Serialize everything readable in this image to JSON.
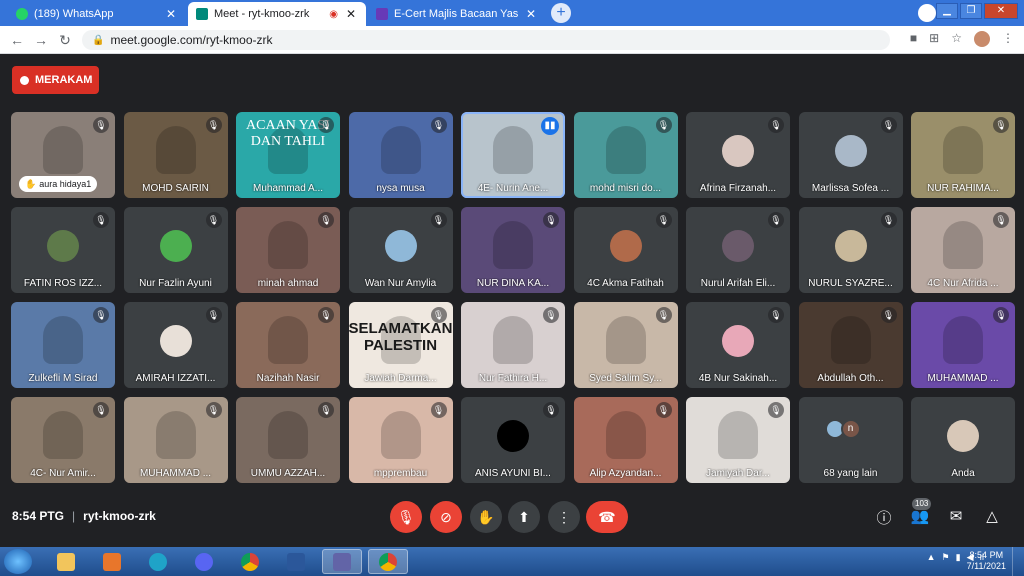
{
  "browser": {
    "tabs": [
      {
        "title": "(189) WhatsApp",
        "favicon_color": "#25d366"
      },
      {
        "title": "Meet - ryt-kmoo-zrk",
        "favicon_color": "#00897b",
        "active": true
      },
      {
        "title": "E-Cert Majlis Bacaan Yasin dan T",
        "favicon_color": "#673ab7"
      }
    ],
    "url": "meet.google.com/ryt-kmoo-zrk"
  },
  "meet": {
    "record_label": "MERAKAM",
    "hand_raised_name": "aura hidaya1",
    "tile_banner_1": "ACAAN YASI DAN TAHLI",
    "tile_banner_2": "SELAMATKAN PALESTIN",
    "participants": [
      {
        "name": "",
        "bg": "#8a7f78"
      },
      {
        "name": "MOHD SAIRIN",
        "bg": "#6b5a45"
      },
      {
        "name": "Muhammad A...",
        "bg": "#2aa8a8"
      },
      {
        "name": "nysa musa",
        "bg": "#4d6aa8"
      },
      {
        "name": "4E- Nurin Ane...",
        "bg": "#b8c4cc"
      },
      {
        "name": "mohd misri do...",
        "bg": "#4a9a9a"
      },
      {
        "name": "Afrina Firzanah...",
        "bg": "#3c4043",
        "avatar": "#d9c7c0"
      },
      {
        "name": "Marlissa Sofea ...",
        "bg": "#3c4043",
        "avatar": "#a9b8c8"
      },
      {
        "name": "NUR RAHIMA...",
        "bg": "#9a8f6a"
      },
      {
        "name": "FATIN ROS IZZ...",
        "bg": "#3c4043",
        "avatar": "#5e7a4a"
      },
      {
        "name": "Nur Fazlin Ayuni",
        "bg": "#3c4043",
        "avatar": "#4caf50"
      },
      {
        "name": "minah ahmad",
        "bg": "#7a5c55"
      },
      {
        "name": "Wan Nur Amylia",
        "bg": "#3c4043",
        "avatar": "#8fb8d8"
      },
      {
        "name": "NUR DINA KA...",
        "bg": "#5a4a78"
      },
      {
        "name": "4C Akma Fatihah",
        "bg": "#3c4043",
        "avatar": "#b06a4a"
      },
      {
        "name": "Nurul Arifah Eli...",
        "bg": "#3c4043",
        "avatar": "#6a5a6a"
      },
      {
        "name": "NURUL SYAZRE...",
        "bg": "#3c4043",
        "avatar": "#c8b89a"
      },
      {
        "name": "4C Nur Afrida ...",
        "bg": "#b8a8a0"
      },
      {
        "name": "Zulkefli M Sirad",
        "bg": "#5a7aa8"
      },
      {
        "name": "AMIRAH IZZATI...",
        "bg": "#3c4043",
        "avatar": "#e8e0d8"
      },
      {
        "name": "Nazihah Nasir",
        "bg": "#8a6a5a"
      },
      {
        "name": "Jawiah Darma...",
        "bg": "#b86a6a"
      },
      {
        "name": "Nur Fathira H...",
        "bg": "#d8d0d0"
      },
      {
        "name": "Syed Salim Sy...",
        "bg": "#c8b8a8"
      },
      {
        "name": "4B Nur Sakinah...",
        "bg": "#3c4043",
        "avatar": "#e8a8b8"
      },
      {
        "name": "Abdullah Oth...",
        "bg": "#4a3a30"
      },
      {
        "name": "MUHAMMAD ...",
        "bg": "#6a4aa8"
      },
      {
        "name": "4C- Nur Amir...",
        "bg": "#8a7a6a"
      },
      {
        "name": "MUHAMMAD ...",
        "bg": "#a89888"
      },
      {
        "name": "UMMU AZZAH...",
        "bg": "#7a6a60"
      },
      {
        "name": "mpprembau",
        "bg": "#d8b8a8"
      },
      {
        "name": "ANIS AYUNI BI...",
        "bg": "#3c4043",
        "avatar": "#000000"
      },
      {
        "name": "Alip Azyandan...",
        "bg": "#a86a5a"
      },
      {
        "name": "Jamiyah Dar...",
        "bg": "#e0dcd8"
      },
      {
        "name": "68 yang lain",
        "bg": "#3c4043"
      },
      {
        "name": "Anda",
        "bg": "#3c4043",
        "avatar": "#d8c8b8"
      }
    ],
    "others_initial": "n"
  },
  "controls": {
    "time": "8:54 PTG",
    "meeting_code": "ryt-kmoo-zrk",
    "participant_count": "103"
  },
  "taskbar": {
    "time": "8:54 PM",
    "date": "7/11/2021"
  }
}
